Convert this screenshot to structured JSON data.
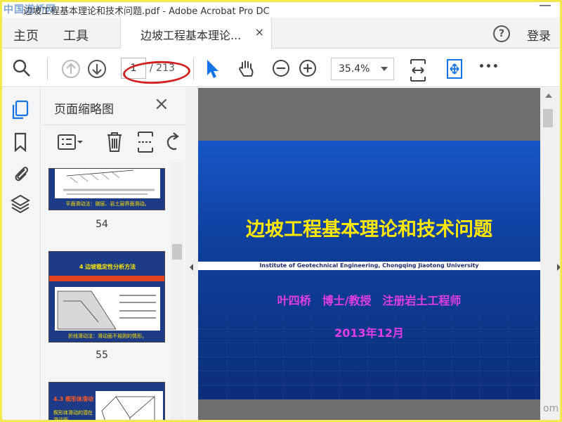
{
  "window": {
    "title": "边坡工程基本理论和技术问题.pdf - Adobe Acrobat Pro DC",
    "watermark": "中国道桥网",
    "min_glyph": "—"
  },
  "tabbar": {
    "home_label": "主页",
    "tools_label": "工具",
    "doc_tab_label": "边坡工程基本理论...",
    "close_glyph": "×",
    "help_glyph": "?",
    "login_label": "登录"
  },
  "toolbar": {
    "current_page": "1",
    "total_pages": "/ 213",
    "zoom": "35.4%",
    "more_glyph": "•••"
  },
  "sidebar": {
    "panel_title": "页面缩略图",
    "close_glyph": "×"
  },
  "thumbnails": [
    {
      "page": "54",
      "caption": "平面滑动法：刚层、岩土层界面滑动。"
    },
    {
      "page": "55",
      "heading": "4 边坡稳定性分析方法",
      "caption": "折线滑动法：滑动面不规则的情形。"
    },
    {
      "page": "56",
      "heading": "4.3 楔形体滑动",
      "caption": "楔形体滑动的潜在滑动面"
    }
  ],
  "slide": {
    "title": "边坡工程基本理论和技术问题",
    "institute": "Institute of Geotechnical Engineering, Chongqing Jiaotong University",
    "author": "叶四桥　博士/教授　注册岩土工程师",
    "date": "2013年12月"
  },
  "watermark_bottom": "om",
  "colors": {
    "accent": "#1473e6",
    "slide_title": "#ffe800",
    "slide_text": "#e23de3",
    "highlight_ellipse": "#d32020",
    "frame": "#f2e94a"
  }
}
